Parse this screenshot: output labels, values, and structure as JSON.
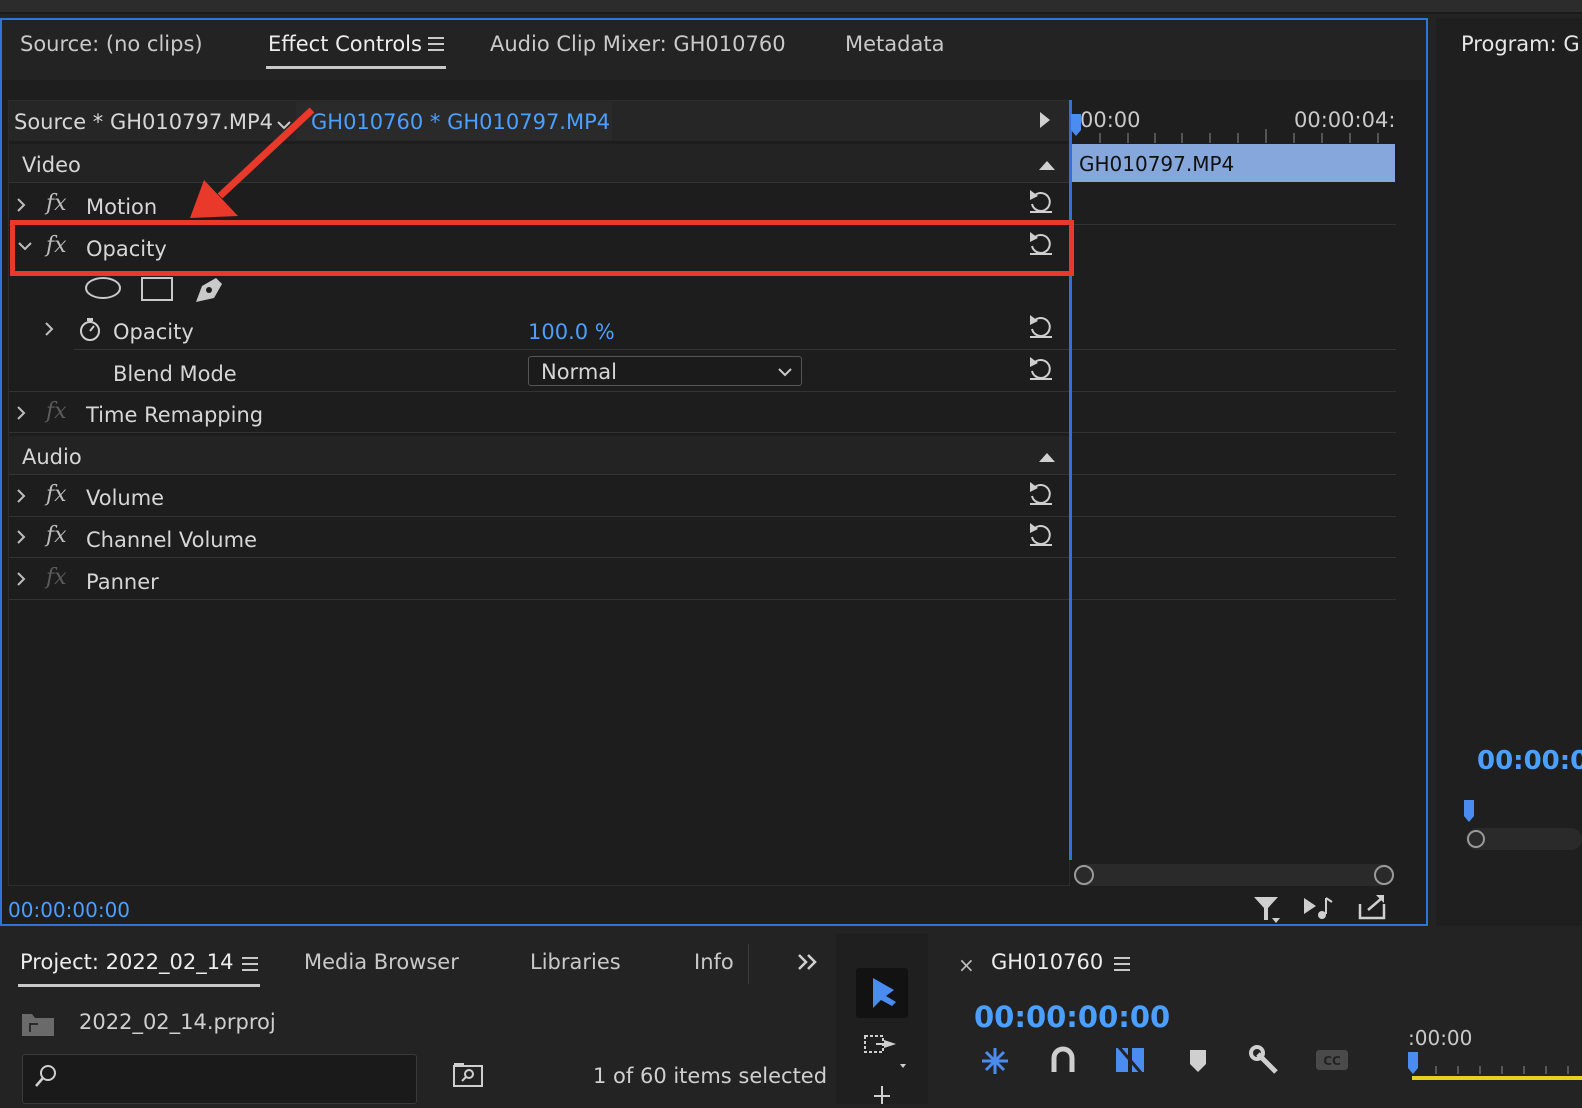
{
  "tabs": {
    "source": "Source: (no clips)",
    "effect_controls": "Effect Controls",
    "audio_mixer": "Audio Clip Mixer: GH010760",
    "metadata": "Metadata",
    "program": "Program: G"
  },
  "effect_controls": {
    "source_label": "Source * GH010797.MP4",
    "sequence_label": "GH010760 * GH010797.MP4",
    "timeline_start": "00:00",
    "timeline_mid": "00:00:04:",
    "clip_name": "GH010797.MP4",
    "video_header": "Video",
    "audio_header": "Audio",
    "effects": {
      "motion": "Motion",
      "opacity": "Opacity",
      "opacity_param": "Opacity",
      "opacity_value": "100.0 %",
      "blend_mode": "Blend Mode",
      "blend_value": "Normal",
      "time_remapping": "Time Remapping",
      "volume": "Volume",
      "channel_volume": "Channel Volume",
      "panner": "Panner"
    },
    "timecode": "00:00:00:00"
  },
  "program": {
    "timecode": "00:00:0"
  },
  "project": {
    "title": "Project: 2022_02_14",
    "media_browser": "Media Browser",
    "libraries": "Libraries",
    "info": "Info",
    "file": "2022_02_14.prproj",
    "selection": "1 of 60 items selected"
  },
  "timeline": {
    "close": "×",
    "name": "GH010760",
    "timecode": "00:00:00:00",
    "ruler": ":00:00"
  },
  "colors": {
    "accent": "#4a9fff",
    "highlight": "#e8392a",
    "clip": "#86a7db"
  }
}
